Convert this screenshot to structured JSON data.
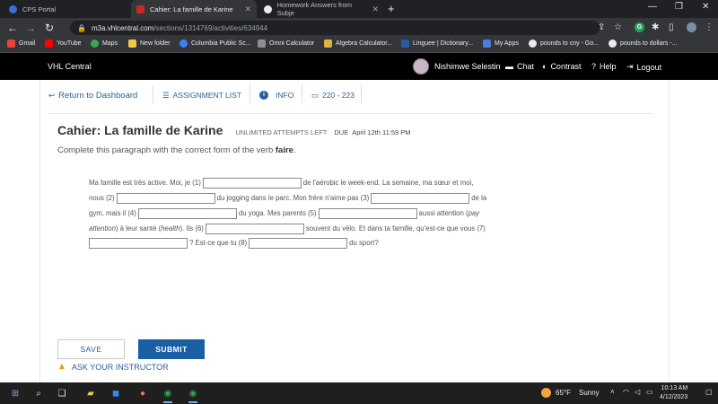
{
  "browser": {
    "tabs": [
      {
        "label": "CPS Portal",
        "active": false
      },
      {
        "label": "Cahier: La famille de Karine",
        "active": true
      },
      {
        "label": "Homework Answers from Subje",
        "active": false
      }
    ],
    "url_host": "m3a.vhlcentral.com",
    "url_path": "/sections/1314769/activities/634944",
    "bookmarks": [
      {
        "label": "Gmail",
        "icon": "gmail-icon",
        "color": "#ea4335"
      },
      {
        "label": "YouTube",
        "icon": "youtube-icon",
        "color": "#ff0000"
      },
      {
        "label": "Maps",
        "icon": "maps-icon",
        "color": "#34a853"
      },
      {
        "label": "New folder",
        "icon": "folder-icon",
        "color": "#f2c94c"
      },
      {
        "label": "Columbia Public Sc...",
        "icon": "globe-icon",
        "color": "#3b82f6"
      },
      {
        "label": "Omni Calculator",
        "icon": "calculator-icon",
        "color": "#8e8e8e"
      },
      {
        "label": "Algebra Calculator...",
        "icon": "algebra-icon",
        "color": "#e0b240"
      },
      {
        "label": "Linguee | Dictionary...",
        "icon": "linguee-icon",
        "color": "#2b5aa4"
      },
      {
        "label": "My Apps",
        "icon": "apps-icon",
        "color": "#4a7be0"
      },
      {
        "label": "pounds to cny - Go...",
        "icon": "google-icon",
        "color": "#e8eaed"
      },
      {
        "label": "pounds to dollars -...",
        "icon": "google-icon",
        "color": "#e8eaed"
      }
    ]
  },
  "vhl": {
    "brand": "VHL Central",
    "user_name": "Nishimwe Selestin",
    "chat": "Chat",
    "contrast": "Contrast",
    "help": "Help",
    "logout": "Logout"
  },
  "subnav": {
    "return": "Return to Dashboard",
    "assignment_list": "ASSIGNMENT LIST",
    "info": "INFO",
    "pages": "220 - 223"
  },
  "activity": {
    "title": "Cahier: La famille de Karine",
    "attempts": "UNLIMITED ATTEMPTS LEFT",
    "due_label": "DUE",
    "due_date": "April 12th 11:59 PM",
    "instructions_prefix": "Complete this paragraph with the correct form of the verb ",
    "instructions_verb": "faire",
    "instructions_suffix": "."
  },
  "paragraph": {
    "l1a": "Ma famille est très active. Moi, je (1)",
    "l1b": "de l'aérobic le week-end. La semaine, ma sœur et moi,",
    "l2a": "nous (2)",
    "l2b": "du jogging dans le parc. Mon frère n'aime pas (3)",
    "l2c": "de la",
    "l3a": "gym, mais il (4)",
    "l3b": "du yoga. Mes parents (5)",
    "l3c": "aussi attention (",
    "l3c_i": "pay",
    "l4a_i": "attention",
    "l4a": ") à leur santé (",
    "l4a_i2": "health",
    "l4a2": "). Ils (6)",
    "l4b": "souvent du vélo. Et dans ta famille, qu'est-ce que vous (7)",
    "l5a": "? Est-ce que tu (8)",
    "l5b": "du sport?"
  },
  "answers": [
    "",
    "",
    "",
    "",
    "",
    "",
    "",
    ""
  ],
  "buttons": {
    "save": "SAVE",
    "submit": "SUBMIT",
    "ask": "ASK YOUR INSTRUCTOR"
  },
  "taskbar": {
    "temperature": "65°F",
    "condition": "Sunny",
    "time": "10:13 AM",
    "date": "4/12/2023"
  },
  "colors": {
    "link_blue": "#2a5d9f",
    "submit_blue": "#1a5ea3",
    "header_black": "#000000"
  }
}
